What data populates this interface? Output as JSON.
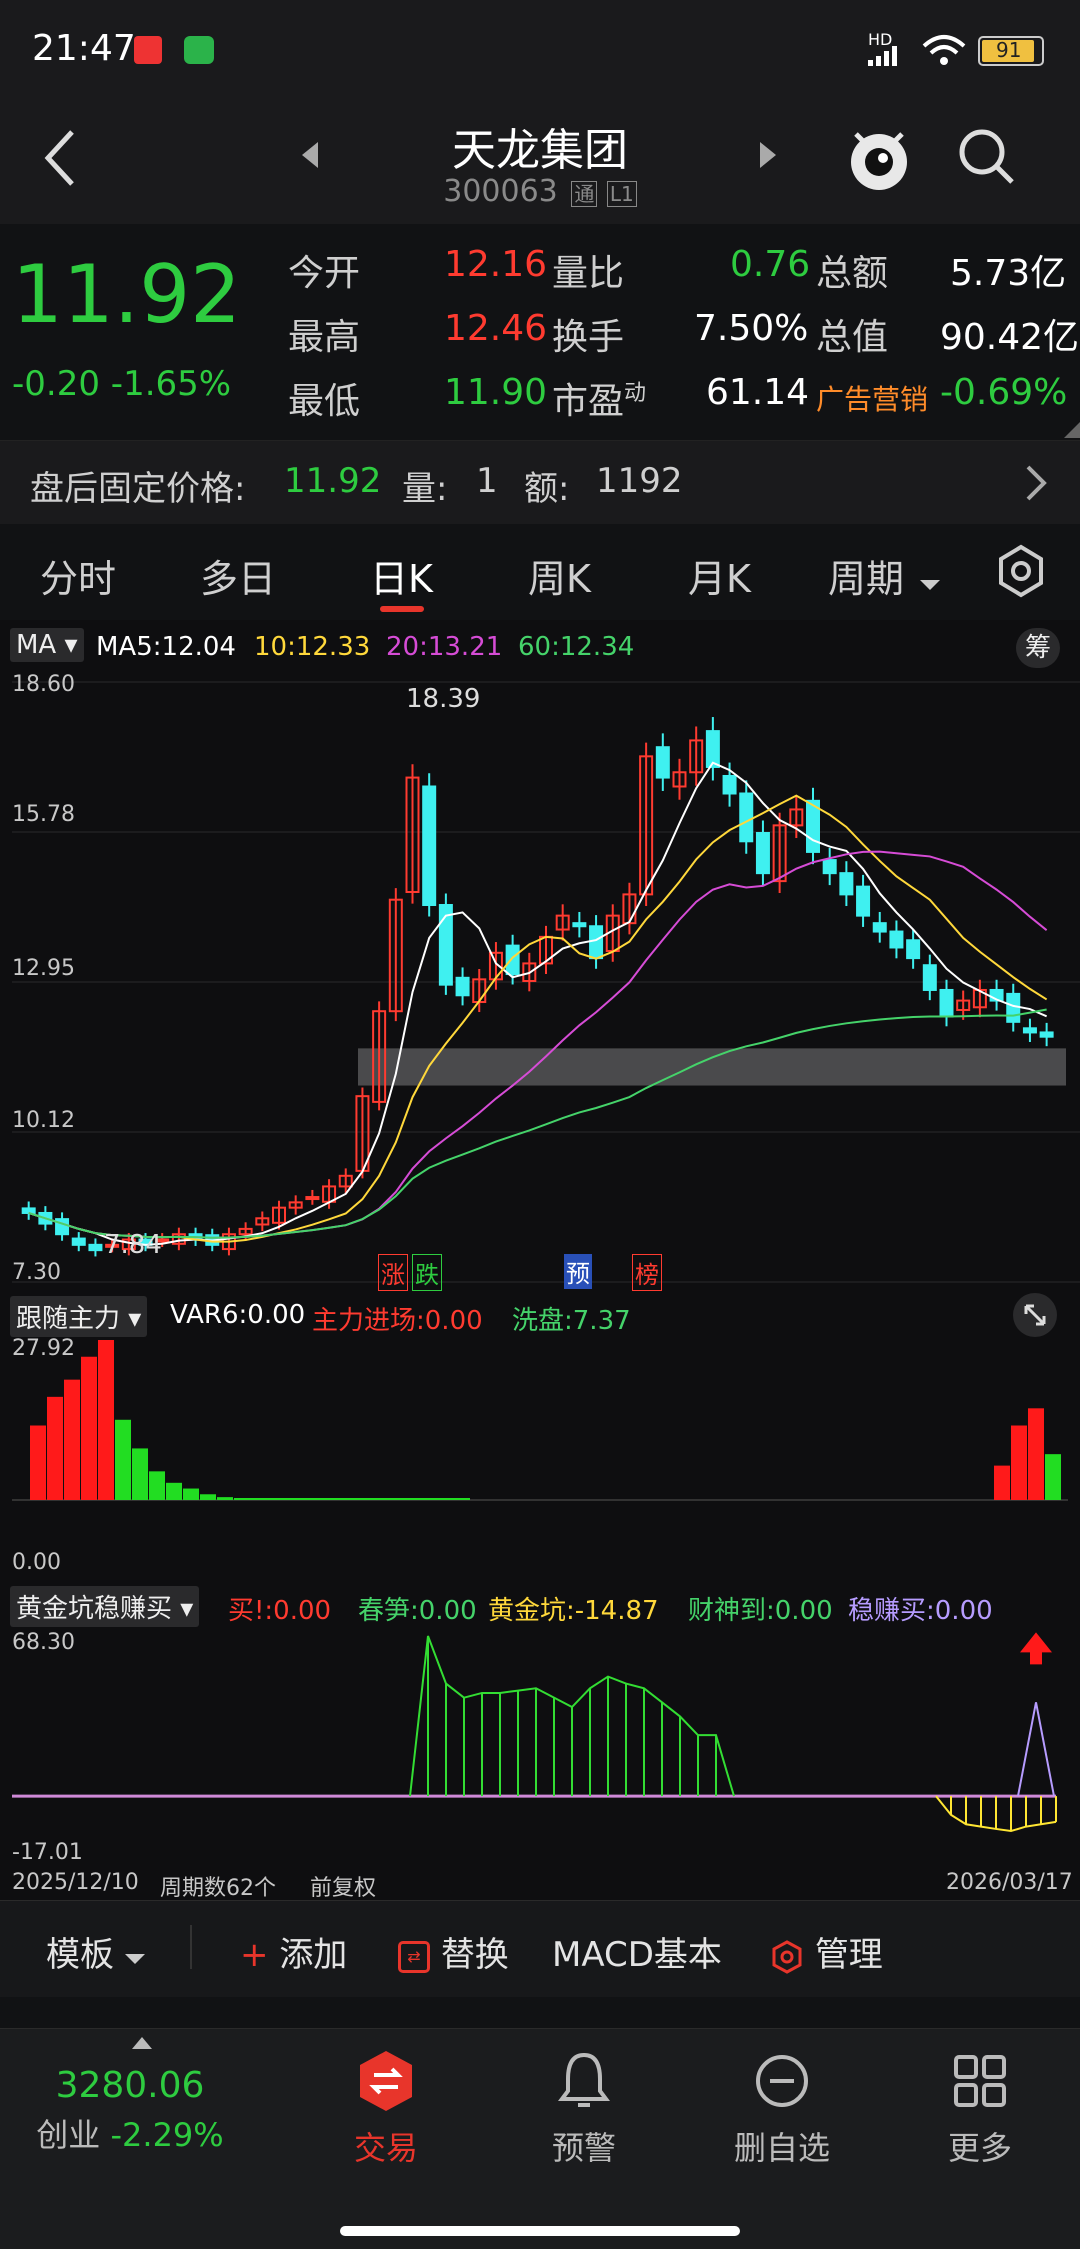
{
  "status": {
    "time": "21:47",
    "hd": "HD",
    "battery": "91"
  },
  "header": {
    "title": "天龙集团",
    "code": "300063",
    "badge1": "通",
    "badge2": "L1"
  },
  "quote": {
    "price": "11.92",
    "change": "-0.20",
    "change_pct": "-1.65%",
    "open_label": "今开",
    "open": "12.16",
    "high_label": "最高",
    "high": "12.46",
    "low_label": "最低",
    "low": "11.90",
    "vr_label": "量比",
    "vr": "0.76",
    "turn_label": "换手",
    "turn": "7.50%",
    "pe_label": "市盈",
    "pe_sup": "动",
    "pe": "61.14",
    "amount_label": "总额",
    "amount": "5.73亿",
    "mv_label": "总值",
    "mv": "90.42亿",
    "sector_label": "广告营销",
    "sector": "-0.69%"
  },
  "afterhours": {
    "label": "盘后固定价格:",
    "price": "11.92",
    "vol_label": "量:",
    "vol": "1",
    "amt_label": "额:",
    "amt": "1192"
  },
  "tabs": [
    "分时",
    "多日",
    "日K",
    "周K",
    "月K",
    "周期"
  ],
  "main_chart": {
    "indicator": "MA",
    "ma5": "MA5:12.04",
    "ma10": "10:12.33",
    "ma20": "20:13.21",
    "ma60": "60:12.34",
    "chip_btn": "筹",
    "yticks": [
      "18.60",
      "15.78",
      "12.95",
      "10.12",
      "7.30"
    ],
    "high_label": "18.39",
    "low_label": "7.84",
    "markers": [
      "涨",
      "跌",
      "预",
      "榜"
    ]
  },
  "sub1": {
    "name": "跟随主力",
    "var6": "VAR6:0.00",
    "enter": "主力进场:0.00",
    "wash": "洗盘:7.37",
    "ytop": "27.92",
    "ybottom": "0.00"
  },
  "sub2": {
    "name": "黄金坑稳赚买",
    "buy": "买!:0.00",
    "spring": "春笋:0.00",
    "pit": "黄金坑:-14.87",
    "god": "财神到:0.00",
    "steady": "稳赚买:0.00",
    "ytop": "68.30",
    "ybottom": "-17.01"
  },
  "footer_axis": {
    "start": "2025/12/10",
    "periods": "周期数62个",
    "adjust": "前复权",
    "end": "2026/03/17"
  },
  "toolbar": {
    "template": "模板",
    "add": "添加",
    "replace": "替换",
    "macd": "MACD基本",
    "manage": "管理"
  },
  "bottomnav": {
    "index_value": "3280.06",
    "index_name": "创业",
    "index_change": "-2.29%",
    "trade": "交易",
    "alert": "预警",
    "remove": "删自选",
    "more": "更多"
  },
  "colors": {
    "up": "#ff3b30",
    "down": "#2ecc40",
    "cyan": "#3ff0f0",
    "accent": "#e8352b"
  },
  "chart_data": [
    {
      "type": "line",
      "title": "",
      "name_hint": "price-kline",
      "ylim": [
        7.3,
        18.6
      ],
      "series": [
        {
          "name": "MA5",
          "values_note": ""
        }
      ],
      "candles_close": [
        8.6,
        8.4,
        8.2,
        8.0,
        7.9,
        8.0,
        8.1,
        8.0,
        8.1,
        8.2,
        8.1,
        8.0,
        8.2,
        8.3,
        8.5,
        8.7,
        8.8,
        8.9,
        9.1,
        9.3,
        10.8,
        12.4,
        14.5,
        16.8,
        14.4,
        12.9,
        12.7,
        13.0,
        13.5,
        13.1,
        13.3,
        13.8,
        14.2,
        14.0,
        13.4,
        14.2,
        14.6,
        17.2,
        16.8,
        16.9,
        17.5,
        17.0,
        16.5,
        15.6,
        15.0,
        15.9,
        16.2,
        15.4,
        15.0,
        14.6,
        14.2,
        13.9,
        13.6,
        13.4,
        12.8,
        12.3,
        12.6,
        12.8,
        12.6,
        12.2,
        12.0,
        11.92
      ]
    },
    {
      "type": "bar",
      "title": "",
      "ylim": [
        0,
        27.92
      ],
      "red": [
        13,
        18,
        21,
        25,
        27.92
      ],
      "green_tail": [
        14,
        9,
        5,
        3,
        2,
        1,
        0.5
      ],
      "recent_red": [
        6,
        13,
        16
      ],
      "recent_green": [
        8
      ]
    },
    {
      "type": "area",
      "title": "",
      "ylim": [
        -17.01,
        68.3
      ],
      "peak": 68.3,
      "trough": -14.87
    }
  ]
}
